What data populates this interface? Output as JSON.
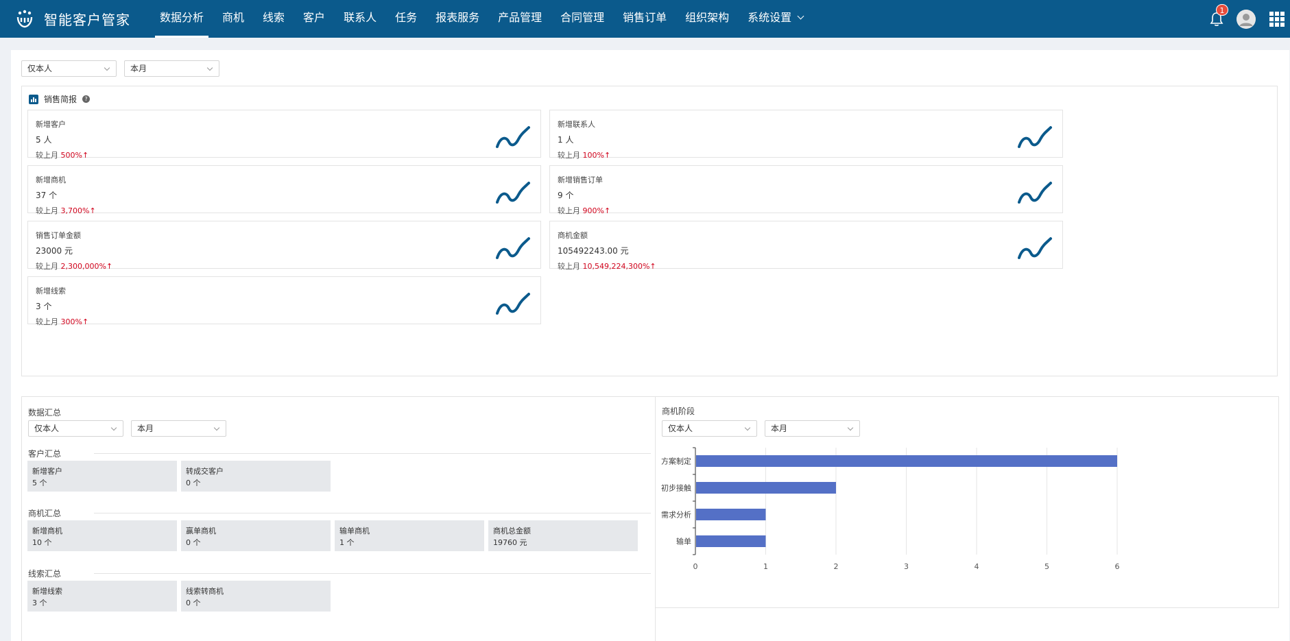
{
  "app": {
    "name": "智能客户管家"
  },
  "nav": [
    {
      "label": "数据分析",
      "active": true
    },
    {
      "label": "商机"
    },
    {
      "label": "线索"
    },
    {
      "label": "客户"
    },
    {
      "label": "联系人"
    },
    {
      "label": "任务"
    },
    {
      "label": "报表服务"
    },
    {
      "label": "产品管理"
    },
    {
      "label": "合同管理"
    },
    {
      "label": "销售订单"
    },
    {
      "label": "组织架构"
    },
    {
      "label": "系统设置"
    }
  ],
  "notifications": {
    "count": "1"
  },
  "filters": {
    "scope": "仅本人",
    "period": "本月"
  },
  "brief": {
    "title": "销售简报",
    "help": "?",
    "compare_label": "较上月",
    "cards": [
      {
        "label": "新增客户",
        "value": "5 人",
        "pct": "500%↑"
      },
      {
        "label": "新增联系人",
        "value": "1 人",
        "pct": "100%↑"
      },
      {
        "label": "新增商机",
        "value": "37 个",
        "pct": "3,700%↑"
      },
      {
        "label": "新增销售订单",
        "value": "9 个",
        "pct": "900%↑"
      },
      {
        "label": "销售订单金额",
        "value": "23000 元",
        "pct": "2,300,000%↑"
      },
      {
        "label": "商机金额",
        "value": "105492243.00 元",
        "pct": "10,549,224,300%↑"
      },
      {
        "label": "新增线索",
        "value": "3 个",
        "pct": "300%↑"
      }
    ]
  },
  "summary": {
    "title": "数据汇总",
    "scope": "仅本人",
    "period": "本月",
    "customer": {
      "title": "客户汇总",
      "items": [
        {
          "label": "新增客户",
          "value": "5 个"
        },
        {
          "label": "转成交客户",
          "value": "0 个"
        }
      ]
    },
    "opportunity": {
      "title": "商机汇总",
      "items": [
        {
          "label": "新增商机",
          "value": "10 个"
        },
        {
          "label": "赢单商机",
          "value": "0 个"
        },
        {
          "label": "输单商机",
          "value": "1 个"
        },
        {
          "label": "商机总金额",
          "value": "19760 元"
        }
      ]
    },
    "leads": {
      "title": "线索汇总",
      "items": [
        {
          "label": "新增线索",
          "value": "3 个"
        },
        {
          "label": "线索转商机",
          "value": "0 个"
        }
      ]
    }
  },
  "stage": {
    "title": "商机阶段",
    "scope": "仅本人",
    "period": "本月"
  },
  "colors": {
    "brand": "#0b5a8c",
    "bar": "#5470c6",
    "up": "#d0021b"
  },
  "chart_data": {
    "type": "bar",
    "orientation": "horizontal",
    "categories": [
      "方案制定",
      "初步接触",
      "需求分析",
      "输单"
    ],
    "values": [
      6,
      2,
      1,
      1
    ],
    "xlim": [
      0,
      6
    ],
    "xticks": [
      "0",
      "1",
      "2",
      "3",
      "4",
      "5",
      "6"
    ],
    "grid": true
  }
}
